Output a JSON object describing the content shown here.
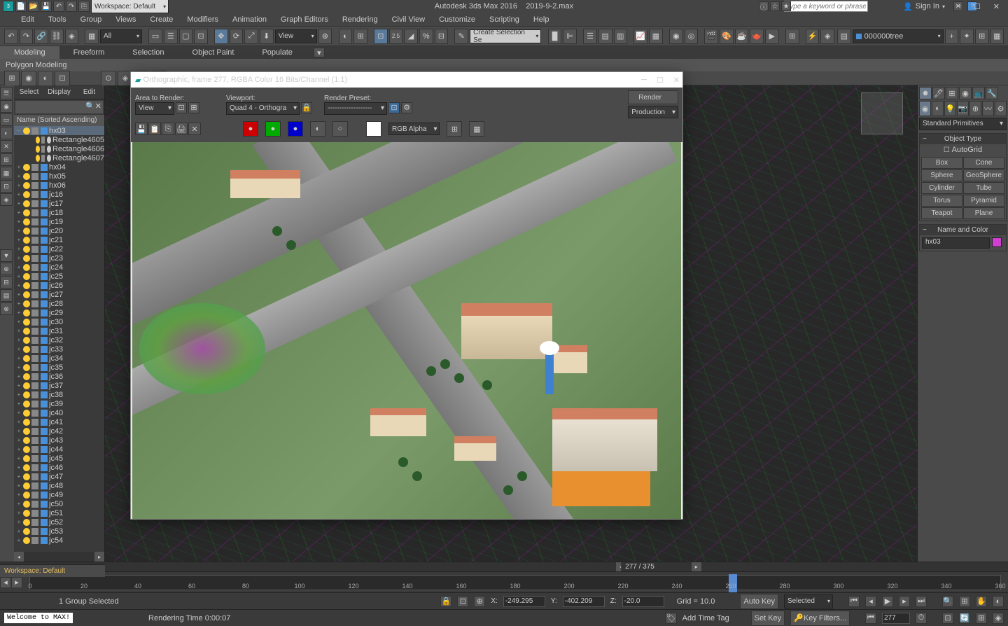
{
  "title": {
    "app": "Autodesk 3ds Max 2016",
    "file": "2019-9-2.max"
  },
  "search_placeholder": "Type a keyword or phrase",
  "signin": "Sign In",
  "workspace_dd": "Workspace: Default",
  "menu": [
    "Edit",
    "Tools",
    "Group",
    "Views",
    "Create",
    "Modifiers",
    "Animation",
    "Graph Editors",
    "Rendering",
    "Civil View",
    "Customize",
    "Scripting",
    "Help"
  ],
  "toolbar": {
    "all": "All",
    "view": "View",
    "create_sel": "Create Selection Se",
    "layer": "000000tree"
  },
  "ribbon": {
    "tabs": [
      "Modeling",
      "Freeform",
      "Selection",
      "Object Paint",
      "Populate"
    ],
    "sub": "Polygon Modeling"
  },
  "outliner": {
    "tabs": [
      "Select",
      "Display",
      "Edit"
    ],
    "title": "Name (Sorted Ascending)",
    "sel": "hx03",
    "children": [
      "Rectangle4605",
      "Rectangle4606",
      "Rectangle4607"
    ],
    "items": [
      "hx04",
      "hx05",
      "hx06",
      "jc16",
      "jc17",
      "jc18",
      "jc19",
      "jc20",
      "jc21",
      "jc22",
      "jc23",
      "jc24",
      "jc25",
      "jc26",
      "jc27",
      "jc28",
      "jc29",
      "jc30",
      "jc31",
      "jc32",
      "jc33",
      "jc34",
      "jc35",
      "jc36",
      "jc37",
      "jc38",
      "jc39",
      "jc40",
      "jc41",
      "jc42",
      "jc43",
      "jc44",
      "jc45",
      "jc46",
      "jc47",
      "jc48",
      "jc49",
      "jc50",
      "jc51",
      "jc52",
      "jc53",
      "jc54"
    ]
  },
  "render_win": {
    "title": "Orthographic, frame 277, RGBA Color 16 Bits/Channel (1:1)",
    "area_label": "Area to Render:",
    "area": "View",
    "viewport_label": "Viewport:",
    "viewport": "Quad 4 - Orthogra",
    "preset_label": "Render Preset:",
    "preset": "-------------------",
    "render_btn": "Render",
    "production": "Production",
    "rgb": "RGB Alpha"
  },
  "right": {
    "dd": "Standard Primitives",
    "sec1": "Object Type",
    "autogrid": "AutoGrid",
    "buttons": [
      "Box",
      "Cone",
      "Sphere",
      "GeoSphere",
      "Cylinder",
      "Tube",
      "Torus",
      "Pyramid",
      "Teapot",
      "Plane"
    ],
    "sec2": "Name and Color",
    "name": "hx03"
  },
  "timeline": {
    "ticks": [
      "0",
      "20",
      "40",
      "60",
      "80",
      "100",
      "120",
      "140",
      "160",
      "180",
      "200",
      "220",
      "240",
      "260",
      "280",
      "300",
      "320",
      "340",
      "360"
    ],
    "pos": "277 / 375",
    "frame": "277"
  },
  "status": {
    "sel": "1 Group Selected",
    "x": "-249.295",
    "y": "-402.209",
    "z": "-20.0",
    "grid": "Grid = 10.0",
    "autokey": "Auto Key",
    "selected": "Selected",
    "setkey": "Set Key",
    "keyfilters": "Key Filters...",
    "addtag": "Add Time Tag",
    "welcome": "Welcome to MAX!",
    "render_time": "Rendering Time  0:00:07"
  },
  "workspace_bar": "Workspace: Default"
}
